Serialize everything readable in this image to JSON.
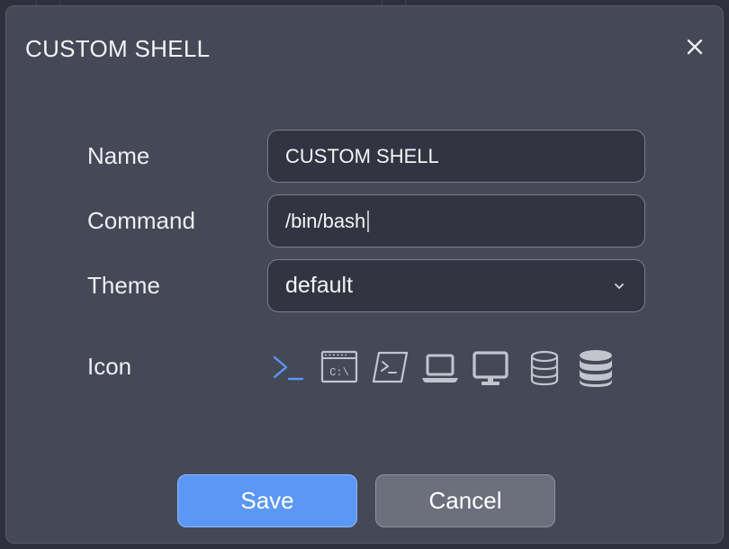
{
  "dialog": {
    "title": "CUSTOM SHELL",
    "close_icon": "close-icon"
  },
  "form": {
    "name_label": "Name",
    "name_value": "CUSTOM SHELL",
    "command_label": "Command",
    "command_value": "/bin/bash",
    "theme_label": "Theme",
    "theme_value": "default",
    "icon_label": "Icon"
  },
  "icons": [
    {
      "name": "terminal-prompt-icon",
      "selected": true
    },
    {
      "name": "windows-console-icon",
      "text": "C:\\",
      "selected": false
    },
    {
      "name": "terminal-window-icon",
      "selected": false
    },
    {
      "name": "laptop-icon",
      "selected": false
    },
    {
      "name": "desktop-monitor-icon",
      "selected": false
    },
    {
      "name": "database-outline-icon",
      "selected": false
    },
    {
      "name": "database-solid-icon",
      "selected": false
    }
  ],
  "buttons": {
    "save_label": "Save",
    "cancel_label": "Cancel"
  },
  "colors": {
    "accent": "#5b97f5",
    "icon_selected": "#5b97f5",
    "icon_default": "#c2c5ce",
    "dialog_bg": "#444857",
    "field_bg": "#323541"
  }
}
